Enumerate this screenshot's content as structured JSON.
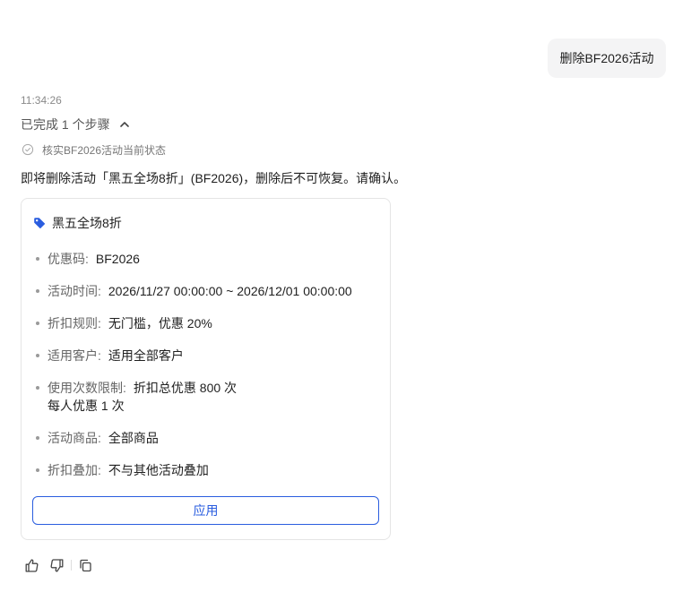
{
  "user_message": "删除BF2026活动",
  "timestamp": "11:34:26",
  "steps": {
    "summary": "已完成 1 个步骤",
    "items": [
      "核实BF2026活动当前状态"
    ]
  },
  "confirm_message": "即将删除活动「黑五全场8折」(BF2026)，删除后不可恢复。请确认。",
  "card": {
    "title": "黑五全场8折",
    "details": [
      {
        "label": "优惠码:",
        "value": "BF2026"
      },
      {
        "label": "活动时间:",
        "value": "2026/11/27 00:00:00 ~ 2026/12/01 00:00:00"
      },
      {
        "label": "折扣规则:",
        "value": "无门槛，优惠 20%"
      },
      {
        "label": "适用客户:",
        "value": "适用全部客户"
      },
      {
        "label": "使用次数限制:",
        "value": "折扣总优惠 800 次",
        "value2": "每人优惠 1 次"
      },
      {
        "label": "活动商品:",
        "value": "全部商品"
      },
      {
        "label": "折扣叠加:",
        "value": "不与其他活动叠加"
      }
    ],
    "apply_label": "应用"
  },
  "icons": {
    "steps_toggle": "chevron-up-icon",
    "step_status": "check-circle-icon",
    "card_header": "tag-icon",
    "feedback": [
      "thumbs-up-icon",
      "thumbs-down-icon",
      "copy-icon"
    ]
  },
  "colors": {
    "accent": "#2a5ddf",
    "bubble_bg": "#f4f4f5",
    "card_border": "#e5e5e5"
  }
}
